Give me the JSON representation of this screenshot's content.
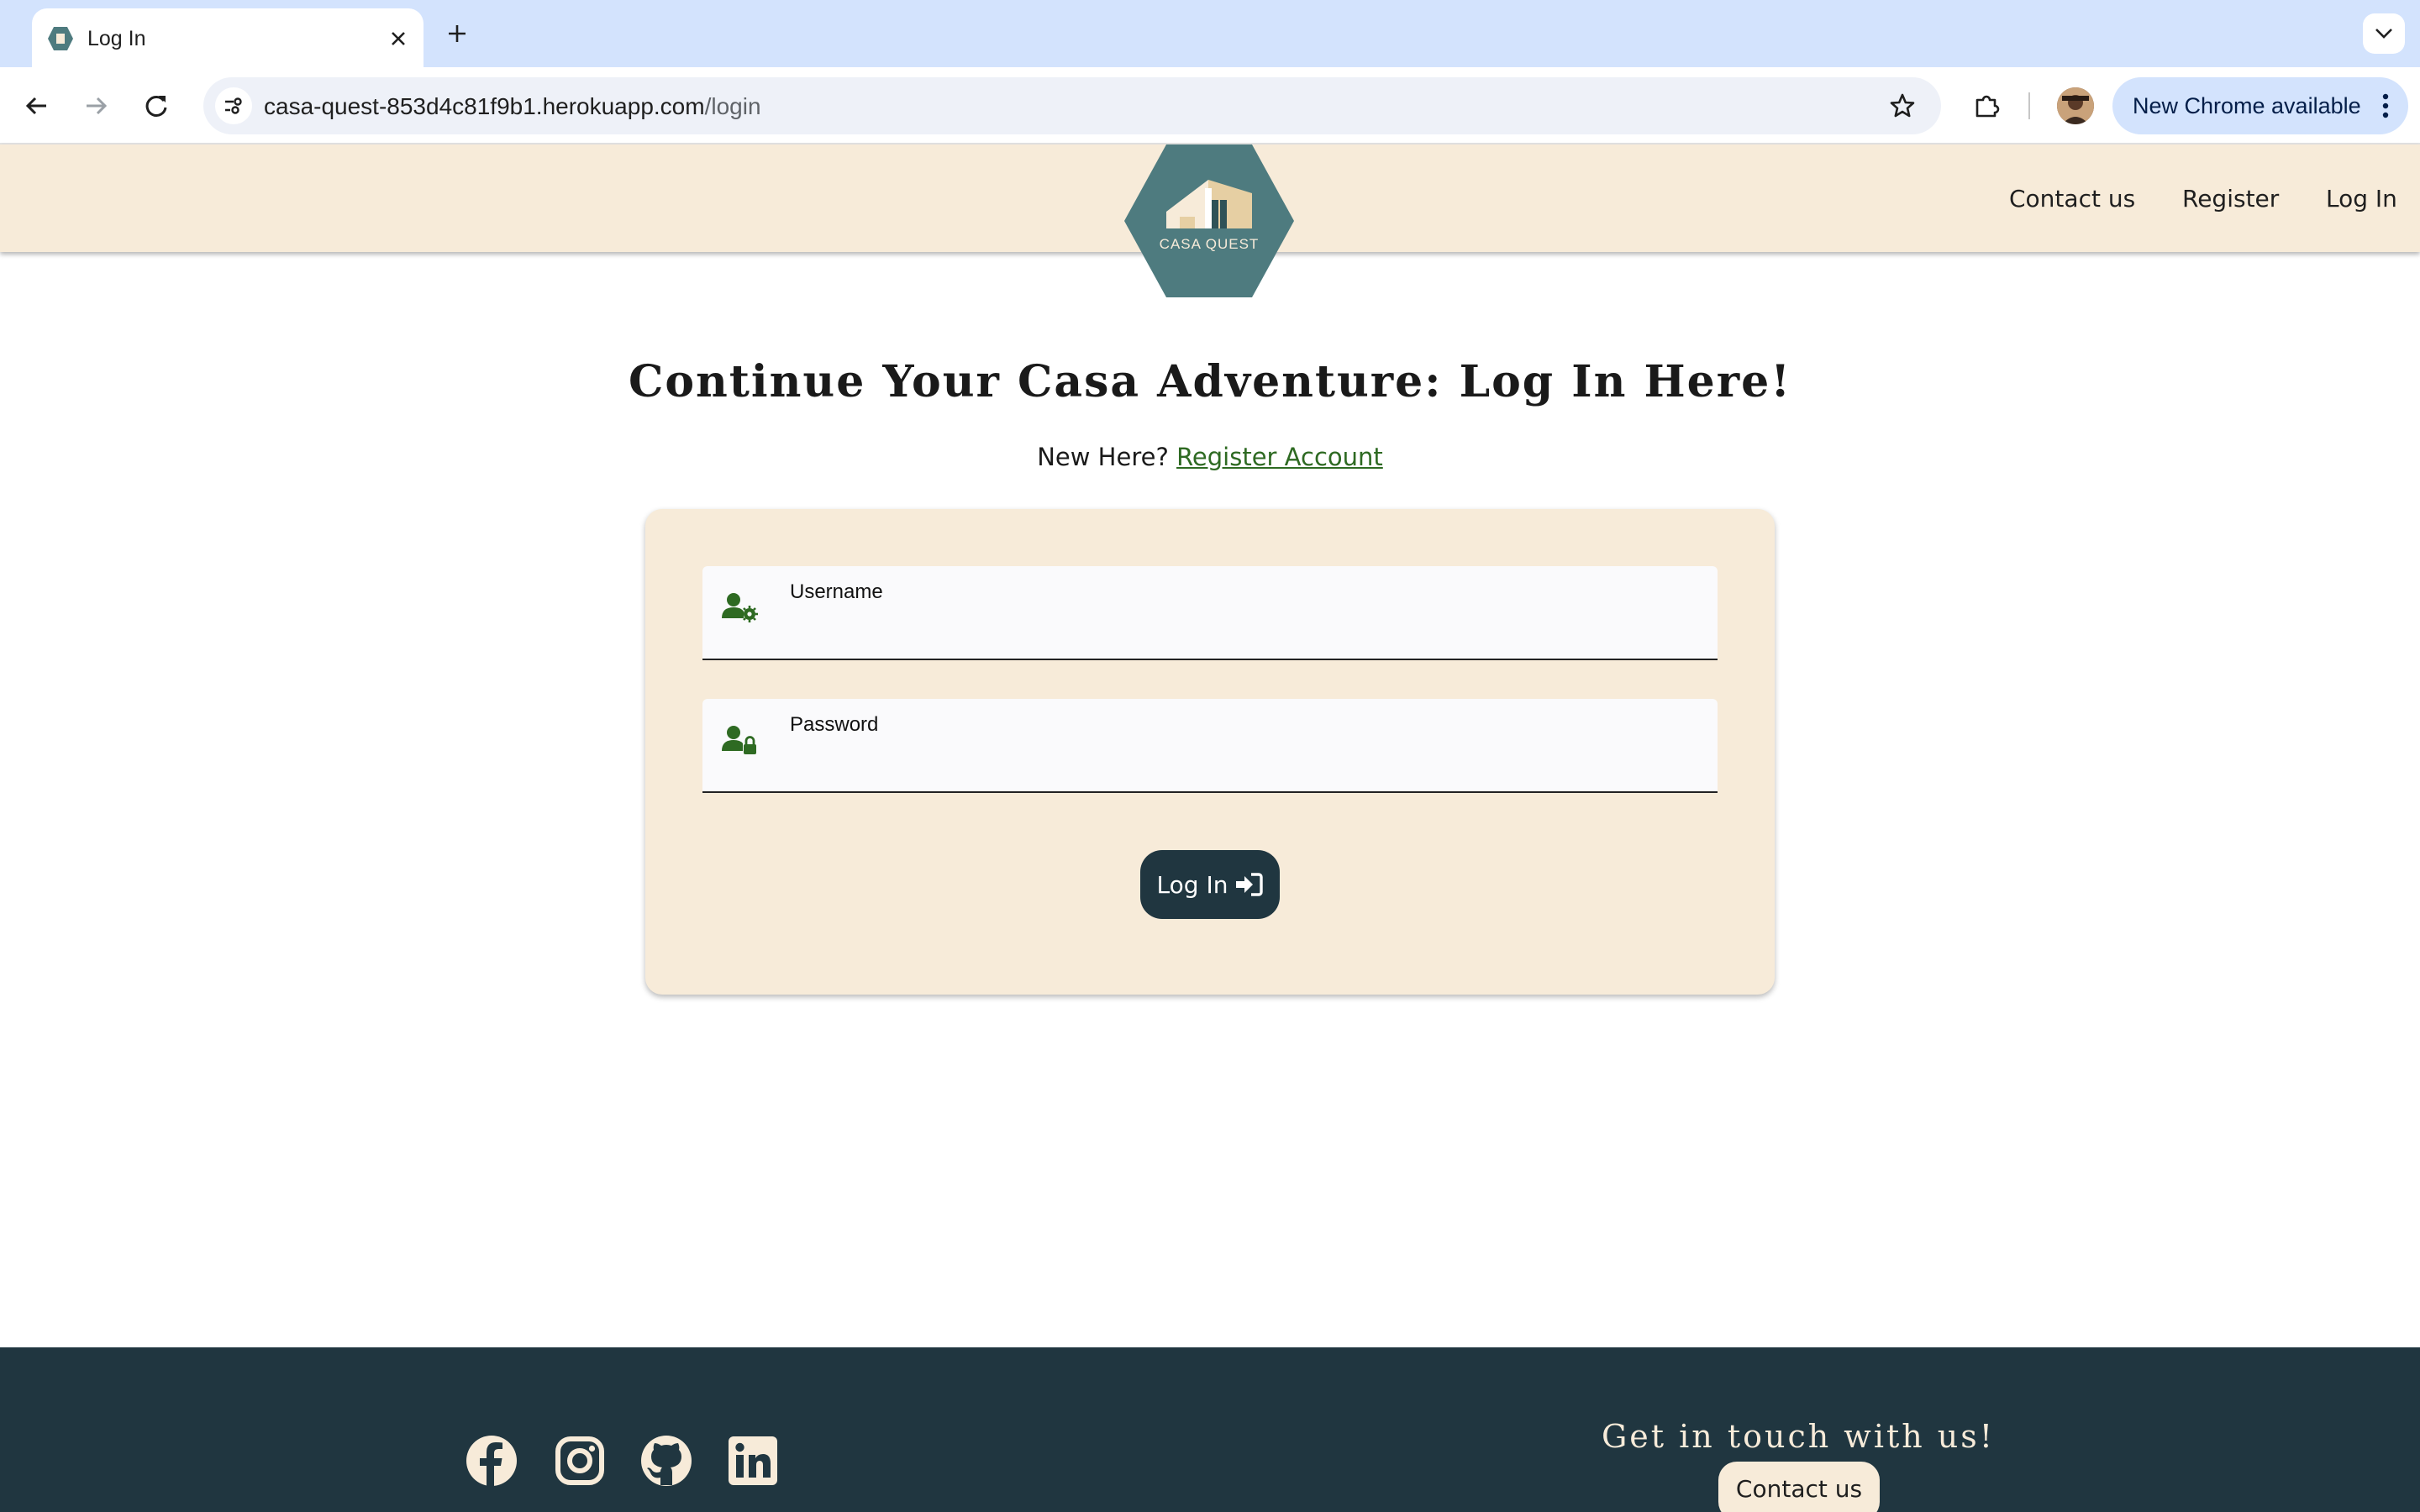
{
  "browser": {
    "tab_title": "Log In",
    "url_host": "casa-quest-853d4c81f9b1.herokuapp.com",
    "url_path": "/login",
    "update_label": "New Chrome available"
  },
  "header": {
    "logo_text": "CASA QUEST",
    "nav": [
      {
        "label": "Contact us"
      },
      {
        "label": "Register"
      },
      {
        "label": "Log In"
      }
    ]
  },
  "main": {
    "title": "Continue Your Casa Adventure: Log In Here!",
    "new_here": "New Here?",
    "register_link": "Register Account",
    "username_label": "Username",
    "password_label": "Password",
    "login_button": "Log In"
  },
  "footer": {
    "social": [
      "facebook-icon",
      "instagram-icon",
      "github-icon",
      "linkedin-icon"
    ],
    "heading": "Get in touch with us!",
    "contact_button": "Contact us"
  },
  "colors": {
    "cream": "#f7ebd9",
    "dark_teal": "#203640",
    "logo_teal": "#4e7b7f",
    "link_green": "#2e6a22"
  }
}
